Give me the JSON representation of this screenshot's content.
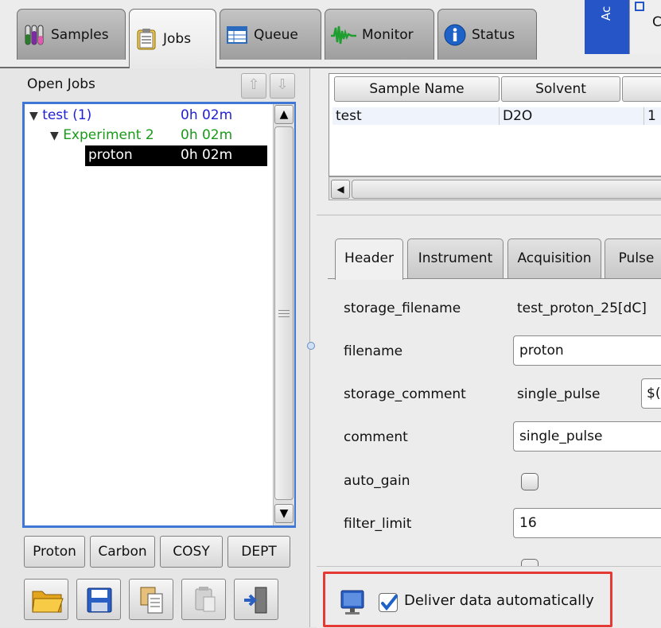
{
  "tabs": [
    {
      "label": "Samples",
      "icon": "test-tubes-icon"
    },
    {
      "label": "Jobs",
      "icon": "clipboard-icon"
    },
    {
      "label": "Queue",
      "icon": "table-icon"
    },
    {
      "label": "Monitor",
      "icon": "waveform-icon"
    },
    {
      "label": "Status",
      "icon": "info-icon"
    }
  ],
  "top_right": {
    "rotated_label": "Ac",
    "partial_label": "C"
  },
  "left": {
    "open_jobs_label": "Open Jobs",
    "tree": [
      {
        "name": "test (1)",
        "time": "0h 02m",
        "color": "#1f1fd6"
      },
      {
        "name": "Experiment 2",
        "time": "0h 02m",
        "color": "#1a9a1a"
      },
      {
        "name": "proton",
        "time": "0h 02m",
        "color": "#ffffff",
        "selected": true
      }
    ],
    "expand_icon": "▼",
    "experiment_buttons": [
      "Proton",
      "Carbon",
      "COSY",
      "DEPT"
    ],
    "tool_icons": [
      "open-folder-icon",
      "save-icon",
      "copy-icon",
      "paste-icon",
      "exit-icon"
    ]
  },
  "table": {
    "columns": [
      "Sample Name",
      "Solvent"
    ],
    "rows": [
      [
        "test",
        "D2O",
        "1"
      ]
    ]
  },
  "param_tabs": [
    "Header",
    "Instrument",
    "Acquisition",
    "Pulse"
  ],
  "params": {
    "storage_filename": {
      "label": "storage_filename",
      "value": "test_proton_25[dC]"
    },
    "filename": {
      "label": "filename",
      "value": "proton"
    },
    "storage_comment": {
      "label": "storage_comment",
      "value": "single_pulse",
      "extra": "$("
    },
    "comment": {
      "label": "comment",
      "value": "single_pulse"
    },
    "auto_gain": {
      "label": "auto_gain",
      "checked": false
    },
    "filter_limit": {
      "label": "filter_limit",
      "value": "16"
    }
  },
  "deliver": {
    "label": "Deliver data automatically",
    "checked": true
  },
  "colors": {
    "accent": "#3e77d6",
    "highlight": "#e53935",
    "selected_bg": "#000000"
  }
}
